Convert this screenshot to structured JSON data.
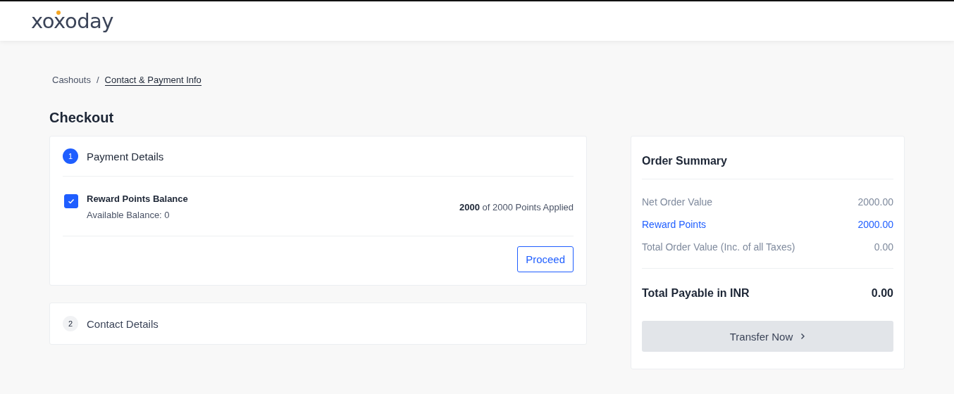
{
  "header": {
    "logo": "xoxoday"
  },
  "breadcrumb_separator": "/",
  "breadcrumb": [
    {
      "label": "Cashouts",
      "current": false
    },
    {
      "label": "Contact & Payment Info",
      "current": true
    }
  ],
  "title": "Checkout",
  "steps": [
    {
      "number": "1",
      "label": "Payment Details",
      "selected": true,
      "balance": {
        "title": "Reward Points Balance",
        "checked": true,
        "available": "Available Balance: 0",
        "applied": "**2000** of 2000 Points Applied"
      },
      "button": "Proceed"
    },
    {
      "number": "2",
      "label": "Contact Details",
      "selected": false
    }
  ],
  "summary": {
    "title": "Order Summary",
    "rows": [
      {
        "label": "Net Order Value",
        "value": "2000.00",
        "kind": "plain"
      },
      {
        "label": "Reward Points",
        "value": "2000.00",
        "kind": "highlight"
      },
      {
        "label": "Total Order Value (Inc. of all Taxes)",
        "value": "0.00",
        "kind": "plain"
      }
    ],
    "total_label": "Total Payable in INR",
    "total_value": "0.00",
    "button": {
      "label": "Transfer Now",
      "disabled": true
    }
  }
}
